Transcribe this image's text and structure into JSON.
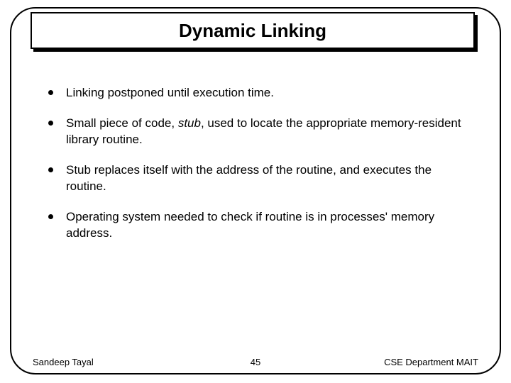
{
  "title": "Dynamic Linking",
  "bullets": [
    {
      "text": "Linking postponed until execution time."
    },
    {
      "pre": "Small piece of code, ",
      "em": "stub",
      "post": ", used to locate the appropriate memory-resident library routine."
    },
    {
      "text": "Stub replaces itself with the address of the routine, and executes the routine."
    },
    {
      "text": "Operating system needed to check if routine is in processes' memory address."
    }
  ],
  "footer": {
    "left": "Sandeep Tayal",
    "center": "45",
    "right": "CSE Department MAIT"
  }
}
